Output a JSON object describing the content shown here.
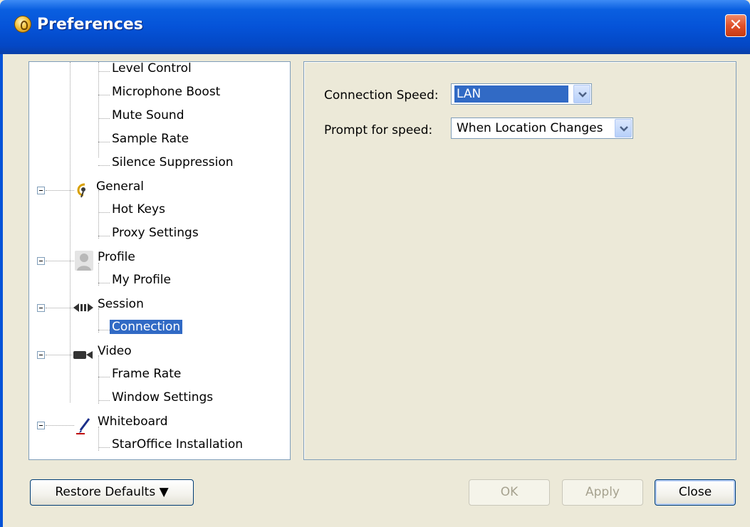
{
  "window": {
    "title": "Preferences",
    "close_glyph": "✕"
  },
  "tree": {
    "items": [
      {
        "label": "Level Control",
        "level": 2
      },
      {
        "label": "Microphone Boost",
        "level": 2
      },
      {
        "label": "Mute Sound",
        "level": 2
      },
      {
        "label": "Sample Rate",
        "level": 2
      },
      {
        "label": "Silence Suppression",
        "level": 2
      },
      {
        "label": "General",
        "level": 1,
        "icon": "general-icon"
      },
      {
        "label": "Hot Keys",
        "level": 2
      },
      {
        "label": "Proxy Settings",
        "level": 2
      },
      {
        "label": "Profile",
        "level": 1,
        "icon": "profile-icon"
      },
      {
        "label": "My Profile",
        "level": 2
      },
      {
        "label": "Session",
        "level": 1,
        "icon": "session-icon"
      },
      {
        "label": "Connection",
        "level": 2,
        "selected": true
      },
      {
        "label": "Video",
        "level": 1,
        "icon": "video-icon"
      },
      {
        "label": "Frame Rate",
        "level": 2
      },
      {
        "label": "Window Settings",
        "level": 2
      },
      {
        "label": "Whiteboard",
        "level": 1,
        "icon": "whiteboard-icon"
      },
      {
        "label": "StarOffice Installation",
        "level": 2
      }
    ]
  },
  "settings": {
    "connection_speed": {
      "label": "Connection Speed:",
      "value": "LAN"
    },
    "prompt_for_speed": {
      "label": "Prompt for speed:",
      "value": "When Location Changes"
    }
  },
  "buttons": {
    "restore_defaults": "Restore Defaults ▼",
    "ok": "OK",
    "apply": "Apply",
    "close": "Close"
  },
  "colors": {
    "titlebar": "#0553d8",
    "selection": "#316ac5",
    "dialog_bg": "#ece9d8"
  }
}
